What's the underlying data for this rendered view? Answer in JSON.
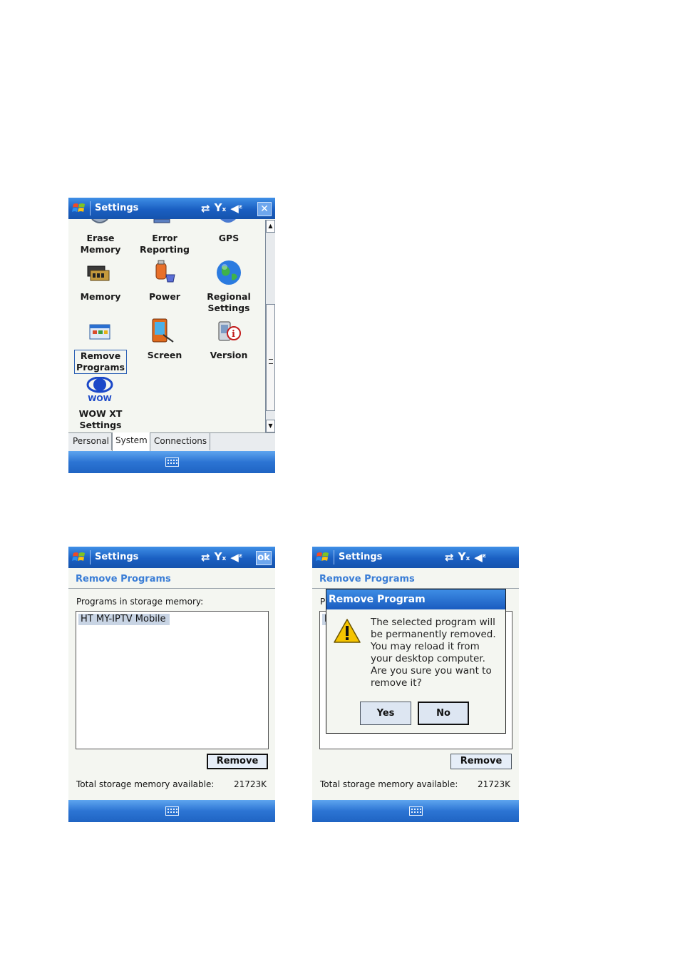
{
  "screen1": {
    "title": "Settings",
    "grid": [
      {
        "label1": "Erase",
        "label2": "Memory"
      },
      {
        "label1": "Error",
        "label2": "Reporting"
      },
      {
        "label1": "GPS",
        "label2": ""
      },
      {
        "label1": "Memory",
        "label2": ""
      },
      {
        "label1": "Power",
        "label2": ""
      },
      {
        "label1": "Regional",
        "label2": "Settings"
      },
      {
        "label1": "Remove",
        "label2": "Programs"
      },
      {
        "label1": "Screen",
        "label2": ""
      },
      {
        "label1": "Version",
        "label2": ""
      },
      {
        "label1": "WOW XT",
        "label2": "Settings"
      }
    ],
    "wow_logo_text": "WOW",
    "tabs": [
      "Personal",
      "System",
      "Connections"
    ],
    "close_glyph": "✕"
  },
  "screen2": {
    "title": "Settings",
    "ok_label": "ok",
    "header": "Remove Programs",
    "list_label": "Programs in storage memory:",
    "programs": [
      "HT MY-IPTV Mobile"
    ],
    "remove_label": "Remove",
    "storage_label": "Total storage memory available:",
    "storage_value": "21723K"
  },
  "screen3": {
    "title": "Settings",
    "header": "Remove Programs",
    "list_label_fragment": "P",
    "list_item_fragment": "H",
    "dialog_title": "Remove Program",
    "dialog_text": "The selected program will be permanently removed. You may reload it from your desktop computer. Are you sure you want to remove it?",
    "yes_label": "Yes",
    "no_label": "No",
    "remove_label": "Remove",
    "storage_label": "Total storage memory available:",
    "storage_value": "21723K"
  },
  "colors": {
    "titlebar": "#1a5fc2",
    "header_text": "#3a7dd6",
    "warning": "#f5c400"
  }
}
